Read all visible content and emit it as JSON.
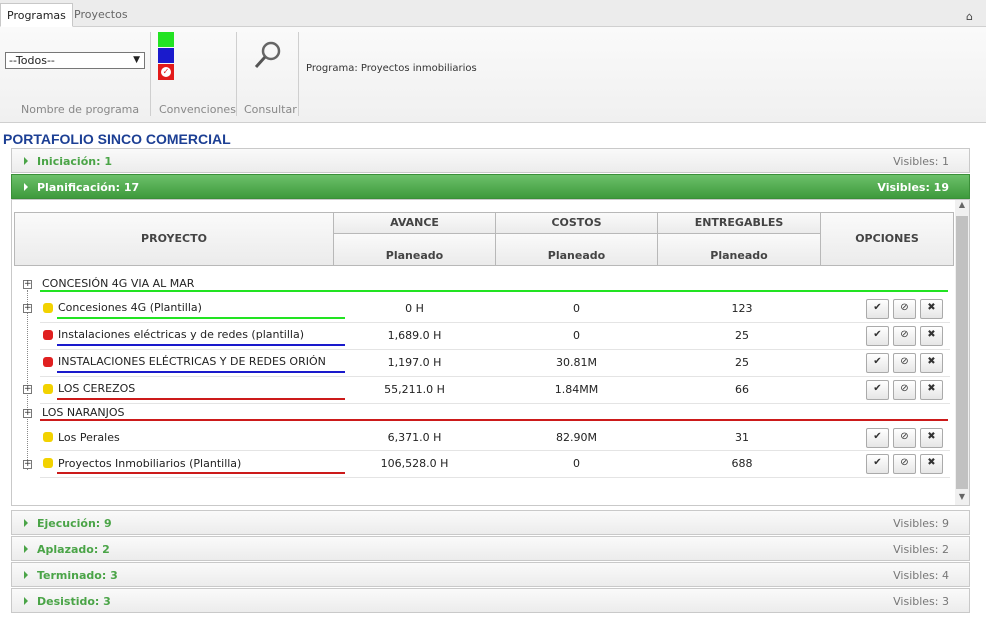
{
  "tabs": [
    {
      "label": "Programas"
    },
    {
      "label": "Proyectos"
    }
  ],
  "ribbon": {
    "program_select": "--Todos--",
    "group_nombre": "Nombre de programa",
    "group_convenciones": "Convenciones",
    "group_consultar": "Consultar",
    "programa_text": "Programa: Proyectos inmobiliarios",
    "colors": {
      "green": "#22e322",
      "blue": "#1a1acc",
      "red": "#e21a1a"
    }
  },
  "page_title": "PORTAFOLIO SINCO COMERCIAL",
  "stages": [
    {
      "label": "Iniciación: 1",
      "visible": "Visibles: 1"
    },
    {
      "label": "Planificación: 17",
      "visible": "Visibles: 19"
    },
    {
      "label": "Ejecución: 9",
      "visible": "Visibles: 9"
    },
    {
      "label": "Aplazado: 2",
      "visible": "Visibles: 2"
    },
    {
      "label": "Terminado: 3",
      "visible": "Visibles: 4"
    },
    {
      "label": "Desistido: 3",
      "visible": "Visibles: 3"
    }
  ],
  "table": {
    "h_proyecto": "PROYECTO",
    "h_avance": "AVANCE",
    "h_costos": "COSTOS",
    "h_entregables": "ENTREGABLES",
    "h_opciones": "OPCIONES",
    "sub": "Planeado",
    "groups": {
      "g1": "CONCESIÓN 4G VIA AL MAR",
      "g2": "LOS NARANJOS"
    },
    "rows": [
      {
        "name": "Concesiones 4G (Plantilla)",
        "avance": "0 H",
        "costos": "0",
        "entregables": "123"
      },
      {
        "name": "Instalaciones eléctricas y de redes (plantilla)",
        "avance": "1,689.0 H",
        "costos": "0",
        "entregables": "25"
      },
      {
        "name": "INSTALACIONES ELÉCTRICAS Y DE REDES ORIÓN",
        "avance": "1,197.0 H",
        "costos": "30.81M",
        "entregables": "25"
      },
      {
        "name": "LOS CEREZOS",
        "avance": "55,211.0 H",
        "costos": "1.84MM",
        "entregables": "66"
      },
      {
        "name": "Los Perales",
        "avance": "6,371.0 H",
        "costos": "82.90M",
        "entregables": "31"
      },
      {
        "name": "Proyectos Inmobiliarios (Plantilla)",
        "avance": "106,528.0 H",
        "costos": "0",
        "entregables": "688"
      }
    ]
  }
}
